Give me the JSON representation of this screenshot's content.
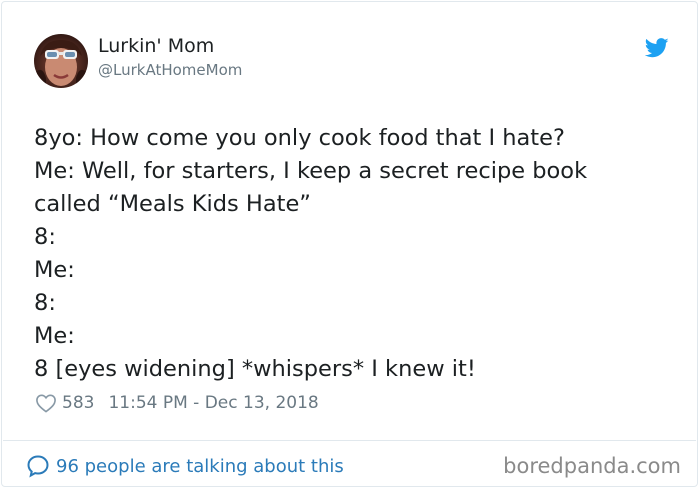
{
  "author": {
    "name": "Lurkin' Mom",
    "handle": "@LurkAtHomeMom"
  },
  "tweet": {
    "lines": [
      "8yo: How come you only cook food that I hate?",
      "Me: Well, for starters, I keep a secret recipe book",
      "called “Meals Kids Hate”",
      "8:",
      "Me:",
      "8:",
      "Me:",
      "8 [eyes widening] *whispers* I knew it!"
    ]
  },
  "meta": {
    "likes": "583",
    "timestamp": "11:54 PM - Dec 13, 2018"
  },
  "footer": {
    "conversation": "96 people are talking about this"
  },
  "watermark": "boredpanda.com",
  "colors": {
    "twitter_blue": "#1da1f2",
    "link_blue": "#2b7bb9",
    "text": "#1c2022",
    "muted": "#697882"
  },
  "icons": {
    "brand": "twitter-bird-icon",
    "like": "heart-icon",
    "conversation": "speech-bubble-icon"
  }
}
